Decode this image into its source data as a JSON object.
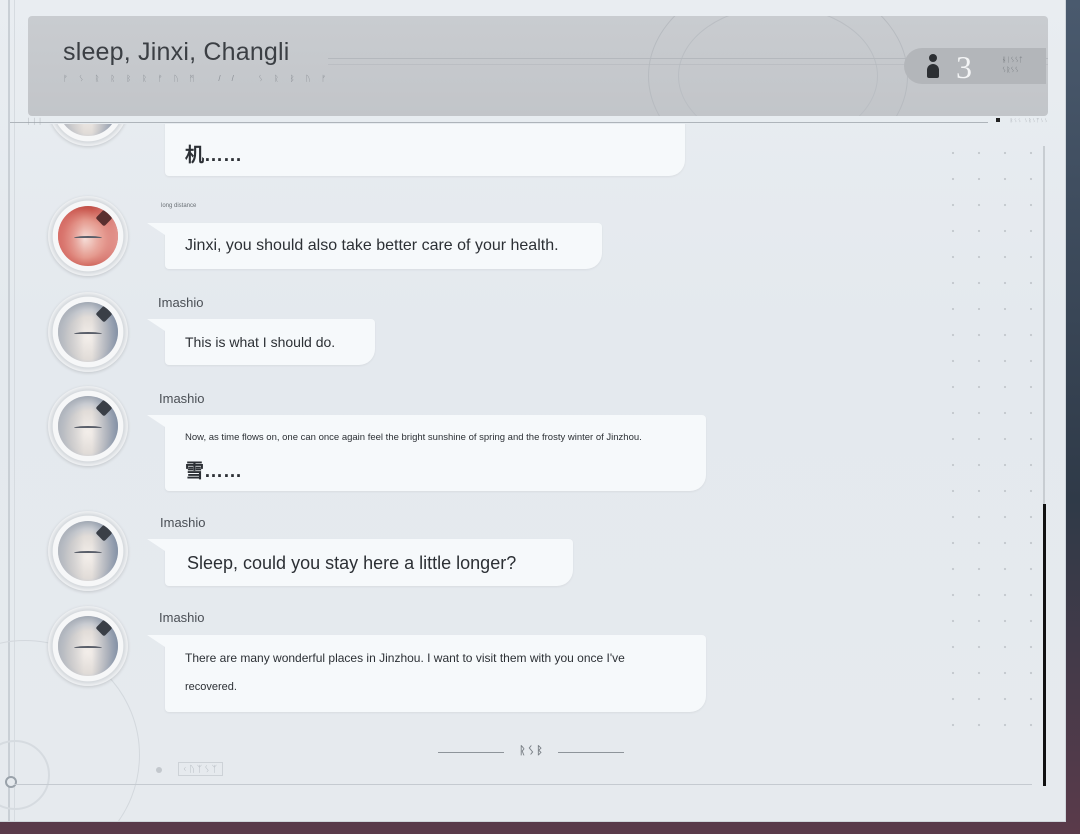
{
  "header": {
    "title": "sleep, Jinxi, Changli",
    "subtitle": "ᚠᛊᚱᚱᛒᚱᚠᚢᛗ // ᛊᚱᛒᚢᚠ",
    "member_count": "3",
    "member_tag": "ᚺᛁᛊᛊᛏ\nᛊᚱᛊᛊ"
  },
  "messages": [
    {
      "sender": "",
      "text": "机……",
      "avatar": "imashio"
    },
    {
      "sender": "long distance",
      "text": "Jinxi, you should also take better care of your health.",
      "avatar": "changli"
    },
    {
      "sender": "Imashio",
      "text": "This is what I should do.",
      "avatar": "imashio"
    },
    {
      "sender": "Imashio",
      "text": "Now, as time flows on, one can once again feel the bright sunshine of spring and the frosty winter of Jinzhou.",
      "text2": "雪……",
      "avatar": "imashio"
    },
    {
      "sender": "Imashio",
      "text": "Sleep, could you stay here a little longer?",
      "avatar": "imashio"
    },
    {
      "sender": "Imashio",
      "text": "There are many wonderful places in Jinzhou. I want to visit them with you once I've",
      "text2": "recovered.",
      "avatar": "imashio"
    }
  ],
  "footer": {
    "mark": "ᚱᛊᛒ",
    "corner_tag": "ᚲᚢᛉᛊᛉ"
  },
  "colors": {
    "bubble_bg": "#f6f9fb",
    "header_bg": "#c4c7cb",
    "scroll_thumb": "#111111"
  }
}
